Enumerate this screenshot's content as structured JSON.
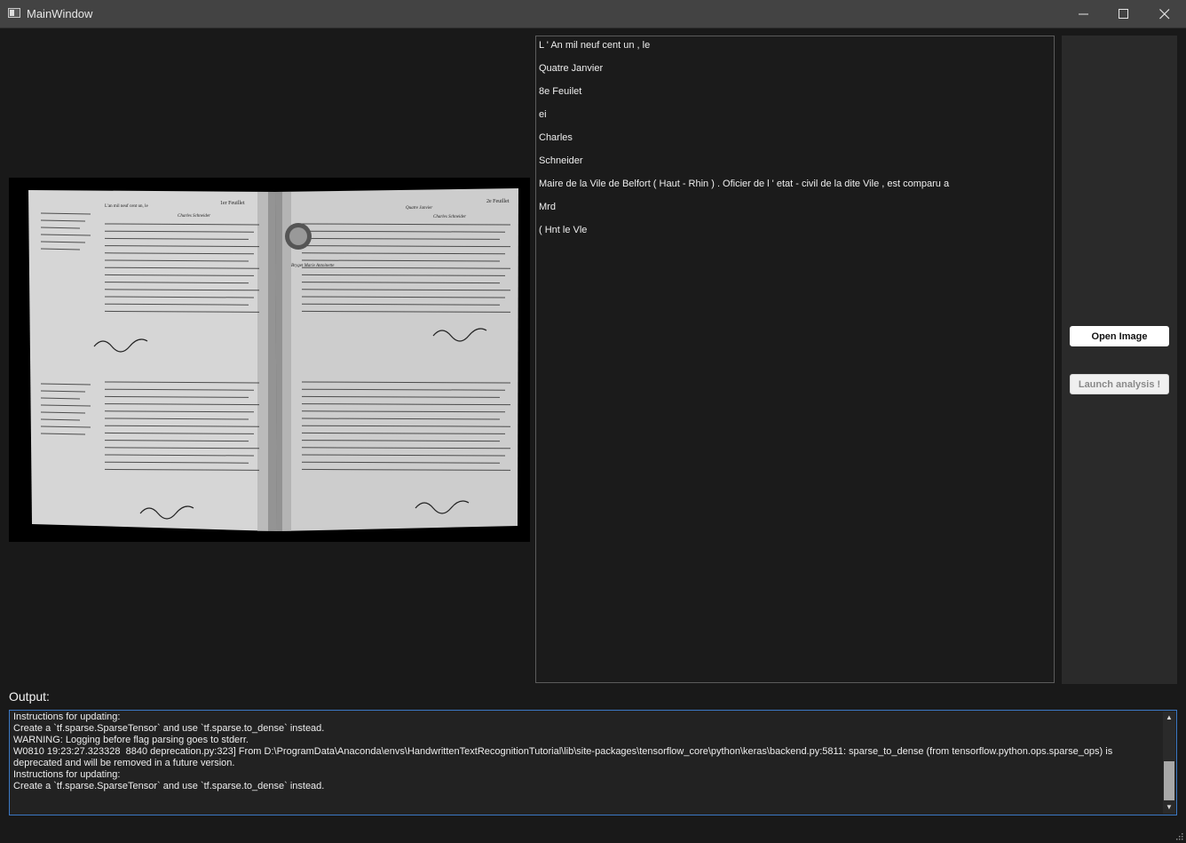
{
  "window": {
    "title": "MainWindow",
    "app_icon": "window-app-icon",
    "controls": [
      "minimize-icon",
      "maximize-icon",
      "close-icon"
    ]
  },
  "image_panel": {
    "scan_left_page_label": "1er Feuillet",
    "scan_right_page_label": "2e Feuillet",
    "scan_left_header_1": "L'an mil neuf cent un, le",
    "scan_left_header_2": "Charles Schneider",
    "scan_right_header_1": "Quatre Janvier",
    "scan_right_header_2": "Charles Schneider",
    "scan_right_margin_name": "Bryget Marie Antoinette"
  },
  "results": {
    "lines": [
      "L ' An mil neuf cent un , le",
      "Quatre Janvier",
      "8e Feuilet",
      "ei",
      "Charles",
      "Schneider",
      "Maire de la Vile de Belfort ( Haut - Rhin ) . Oficier de l ' etat - civil de la dite Vile , est comparu a",
      "Mrd",
      "( Hnt le Vle"
    ]
  },
  "actions": {
    "open_image": "Open Image",
    "launch_analysis": "Launch analysis !"
  },
  "output": {
    "label": "Output:",
    "log": "Instructions for updating:\nCreate a `tf.sparse.SparseTensor` and use `tf.sparse.to_dense` instead.\nWARNING: Logging before flag parsing goes to stderr.\nW0810 19:23:27.323328  8840 deprecation.py:323] From D:\\ProgramData\\Anaconda\\envs\\HandwrittenTextRecognitionTutorial\\lib\\site-packages\\tensorflow_core\\python\\keras\\backend.py:5811: sparse_to_dense (from tensorflow.python.ops.sparse_ops) is deprecated and will be removed in a future version.\nInstructions for updating:\nCreate a `tf.sparse.SparseTensor` and use `tf.sparse.to_dense` instead."
  },
  "colors": {
    "window_bg": "#191919",
    "titlebar_bg": "#434343",
    "panel_bg": "#2a2a2a",
    "focus_border": "#3b78c4"
  }
}
